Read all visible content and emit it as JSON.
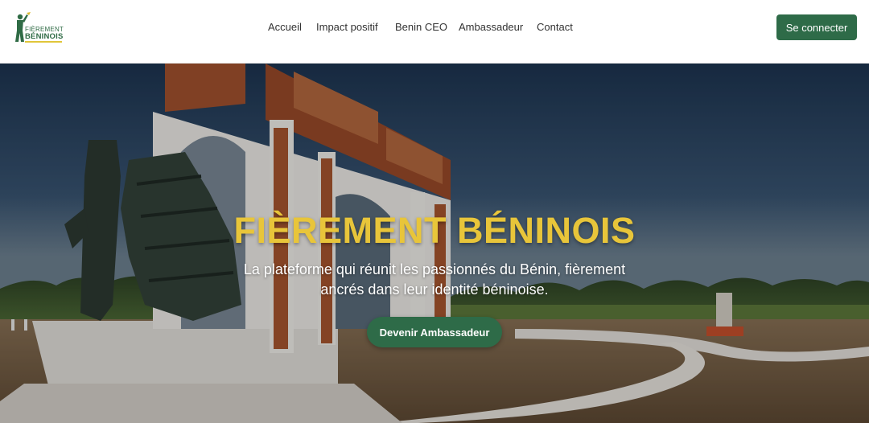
{
  "brand": {
    "logo_top": "FIÈREMENT",
    "logo_bottom": "BÉNINOIS"
  },
  "nav": {
    "items": [
      {
        "label": "Accueil"
      },
      {
        "label": "Impact positif"
      },
      {
        "label": "Benin CEO"
      },
      {
        "label": "Ambassadeur"
      },
      {
        "label": "Contact"
      }
    ],
    "login_label": "Se connecter"
  },
  "hero": {
    "title": "FIÈREMENT BÉNINOIS",
    "subtitle": "La plateforme qui réunit les passionnés du Bénin, fièrement ancrés dans leur identité béninoise.",
    "cta_label": "Devenir Ambassadeur"
  },
  "colors": {
    "brand_green": "#2e6b48",
    "title_yellow": "#e8c53a"
  }
}
